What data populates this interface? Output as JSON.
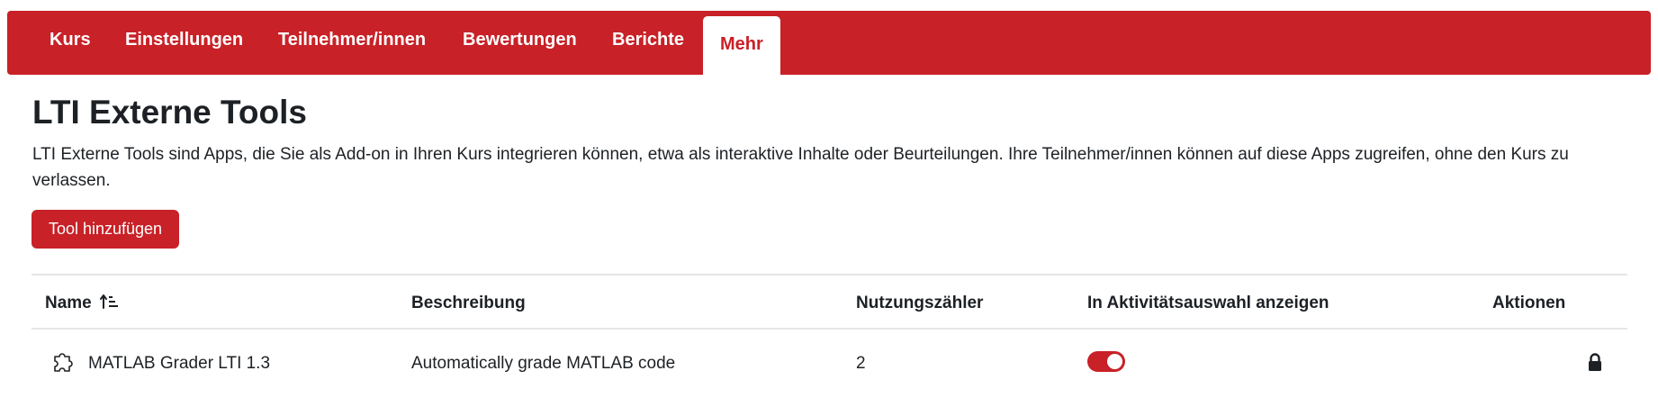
{
  "nav": {
    "tabs": [
      {
        "label": "Kurs"
      },
      {
        "label": "Einstellungen"
      },
      {
        "label": "Teilnehmer/innen"
      },
      {
        "label": "Bewertungen"
      },
      {
        "label": "Berichte"
      },
      {
        "label": "Mehr",
        "active": true
      }
    ]
  },
  "page": {
    "title": "LTI Externe Tools",
    "description": "LTI Externe Tools sind Apps, die Sie als Add-on in Ihren Kurs integrieren können, etwa als interaktive Inhalte oder Beurteilungen. Ihre Teilnehmer/innen können auf diese Apps zugreifen, ohne den Kurs zu verlassen.",
    "add_button": "Tool hinzufügen"
  },
  "table": {
    "headers": {
      "name": "Name",
      "description": "Beschreibung",
      "usage": "Nutzungszähler",
      "show_in_chooser": "In Aktivitätsauswahl anzeigen",
      "actions": "Aktionen"
    },
    "rows": [
      {
        "icon": "puzzle-icon",
        "name": "MATLAB Grader LTI 1.3",
        "description": "Automatically grade MATLAB code",
        "usage": "2",
        "show_in_chooser": true,
        "action_icon": "lock-icon"
      }
    ]
  },
  "colors": {
    "brand": "#c82127",
    "text": "#1d2125",
    "border": "#e6e6e6"
  }
}
